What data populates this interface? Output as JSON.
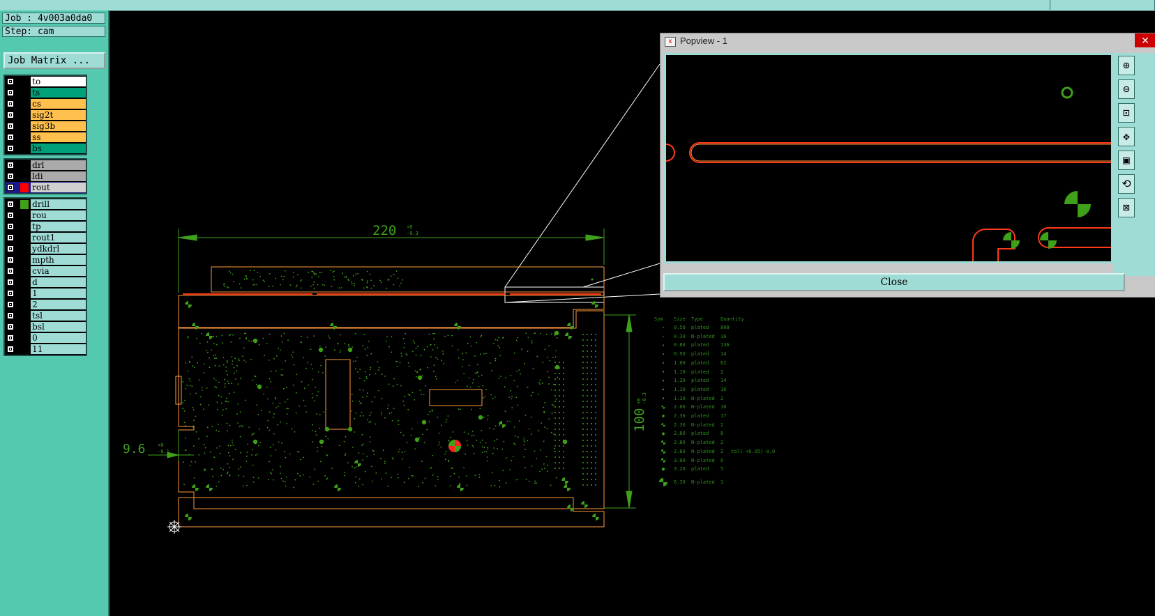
{
  "job": {
    "job_line": "Job : 4v003a0da0",
    "step_line": "Step: cam",
    "matrix_button": "Job Matrix ..."
  },
  "colors": {
    "signal": "#ffc04d",
    "mask": "#00a07a",
    "silk": "#ffffff",
    "drill_layer": "#aaaaaa",
    "misc": "#9fdcd6",
    "outline": "#ff9a3d",
    "pad": "#3fa01a"
  },
  "layer_groups": [
    [
      {
        "name": "to",
        "bg": "#ffffff",
        "swatch": ""
      },
      {
        "name": "ts",
        "bg": "#00a07a",
        "swatch": ""
      },
      {
        "name": "cs",
        "bg": "#ffc04d",
        "swatch": ""
      },
      {
        "name": "sig2t",
        "bg": "#ffc04d",
        "swatch": ""
      },
      {
        "name": "sig3b",
        "bg": "#ffc04d",
        "swatch": ""
      },
      {
        "name": "ss",
        "bg": "#ffc04d",
        "swatch": ""
      },
      {
        "name": "bs",
        "bg": "#00a07a",
        "swatch": ""
      }
    ],
    [
      {
        "name": "drl",
        "bg": "#aaaaaa",
        "swatch": ""
      },
      {
        "name": "ldi",
        "bg": "#aaaaaa",
        "swatch": ""
      },
      {
        "name": "rout",
        "bg": "#d0d0d0",
        "swatch": "#ff0000",
        "active": true
      }
    ],
    [
      {
        "name": "drill",
        "bg": "#9fdcd6",
        "swatch": "#3fa01a"
      },
      {
        "name": "rou",
        "bg": "#9fdcd6",
        "swatch": ""
      },
      {
        "name": "tp",
        "bg": "#9fdcd6",
        "swatch": ""
      },
      {
        "name": "rout1",
        "bg": "#9fdcd6",
        "swatch": ""
      },
      {
        "name": "ydkdrl",
        "bg": "#9fdcd6",
        "swatch": ""
      },
      {
        "name": "mpth",
        "bg": "#9fdcd6",
        "swatch": ""
      },
      {
        "name": "cvia",
        "bg": "#9fdcd6",
        "swatch": ""
      },
      {
        "name": "d",
        "bg": "#9fdcd6",
        "swatch": ""
      },
      {
        "name": "1",
        "bg": "#9fdcd6",
        "swatch": ""
      },
      {
        "name": "2",
        "bg": "#9fdcd6",
        "swatch": ""
      },
      {
        "name": "tsl",
        "bg": "#9fdcd6",
        "swatch": ""
      },
      {
        "name": "bsl",
        "bg": "#9fdcd6",
        "swatch": ""
      },
      {
        "name": "0",
        "bg": "#9fdcd6",
        "swatch": ""
      },
      {
        "name": "11",
        "bg": "#9fdcd6",
        "swatch": ""
      }
    ]
  ],
  "dimensions": {
    "width_value": "220",
    "width_tol_plus": "+0",
    "width_tol_minus": "-0.3",
    "height_value": "100",
    "height_tol_plus": "+0",
    "height_tol_minus": "-0.3",
    "edge_value": "9.6",
    "edge_tol_plus": "+0",
    "edge_tol_minus": "-0.1"
  },
  "drill_table": {
    "headers": {
      "sym": "Sym",
      "size": "Size",
      "type": "Type",
      "qty": "Quantity"
    },
    "rows": [
      {
        "size": "0.50",
        "type": "plated",
        "qty": "808",
        "note": ""
      },
      {
        "size": "0.30",
        "type": "N-plated",
        "qty": "16",
        "note": ""
      },
      {
        "size": "0.80",
        "type": "plated",
        "qty": "136",
        "note": ""
      },
      {
        "size": "0.90",
        "type": "plated",
        "qty": "14",
        "note": ""
      },
      {
        "size": "1.00",
        "type": "plated",
        "qty": "62",
        "note": ""
      },
      {
        "size": "1.10",
        "type": "plated",
        "qty": "2",
        "note": ""
      },
      {
        "size": "1.20",
        "type": "plated",
        "qty": "14",
        "note": ""
      },
      {
        "size": "1.30",
        "type": "plated",
        "qty": "16",
        "note": ""
      },
      {
        "size": "1.30",
        "type": "N-plated",
        "qty": "2",
        "note": ""
      },
      {
        "size": "2.00",
        "type": "N-plated",
        "qty": "16",
        "note": ""
      },
      {
        "size": "2.30",
        "type": "plated",
        "qty": "17",
        "note": ""
      },
      {
        "size": "2.30",
        "type": "N-plated",
        "qty": "2",
        "note": ""
      },
      {
        "size": "2.80",
        "type": "plated",
        "qty": "8",
        "note": ""
      },
      {
        "size": "2.80",
        "type": "N-plated",
        "qty": "2",
        "note": ""
      },
      {
        "size": "2.80",
        "type": "N-plated",
        "qty": "2",
        "note": "toll +0.05/-0.0"
      },
      {
        "size": "3.00",
        "type": "N-plated",
        "qty": "6",
        "note": ""
      },
      {
        "size": "3.20",
        "type": "plated",
        "qty": "5",
        "note": ""
      },
      {
        "size": "6.30",
        "type": "N-plated",
        "qty": "1",
        "note": ""
      }
    ]
  },
  "popview": {
    "title": "Popview - 1",
    "close_label": "Close",
    "tools": [
      "zoom-in-icon",
      "zoom-out-icon",
      "zoom-home-icon",
      "pan-icon",
      "fit-icon",
      "rotate-icon",
      "measure-icon"
    ]
  }
}
